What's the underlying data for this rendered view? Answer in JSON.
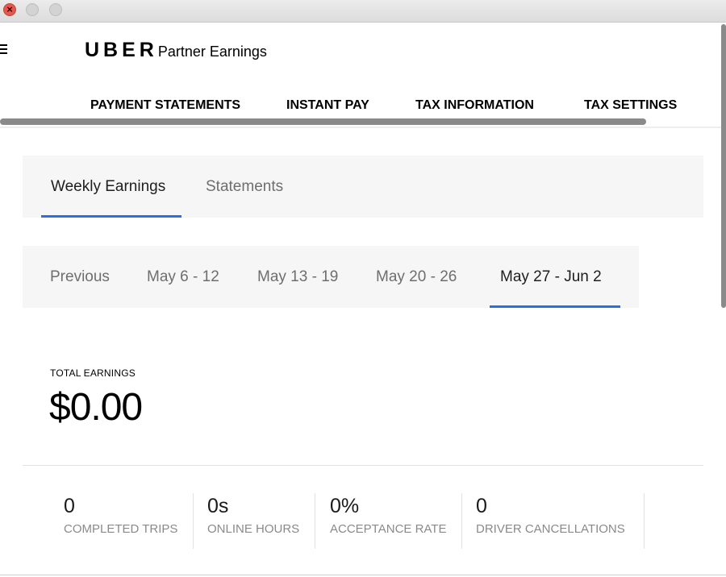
{
  "window": {
    "close_symbol": "×"
  },
  "header": {
    "brand": "UBER",
    "product": "Partner Earnings",
    "menu_icon": "hamburger-icon"
  },
  "topnav": {
    "items": [
      "PAYMENT STATEMENTS",
      "INSTANT PAY",
      "TAX INFORMATION",
      "TAX SETTINGS"
    ]
  },
  "tabs": {
    "items": [
      "Weekly Earnings",
      "Statements"
    ],
    "active": "Weekly Earnings"
  },
  "weeks": {
    "items": [
      "Previous",
      "May 6 - 12",
      "May 13 - 19",
      "May 20 - 26",
      "May 27 - Jun 2"
    ],
    "active": "May 27 - Jun 2"
  },
  "earnings": {
    "total_label": "TOTAL EARNINGS",
    "total_value": "$0.00"
  },
  "stats": [
    {
      "value": "0",
      "label": "COMPLETED TRIPS"
    },
    {
      "value": "0s",
      "label": "ONLINE HOURS"
    },
    {
      "value": "0%",
      "label": "ACCEPTANCE RATE"
    },
    {
      "value": "0",
      "label": "DRIVER CANCELLATIONS"
    }
  ],
  "colors": {
    "accent": "#276ef1",
    "tab_background": "#f6f6f6",
    "muted_text": "#8a8a8a"
  }
}
